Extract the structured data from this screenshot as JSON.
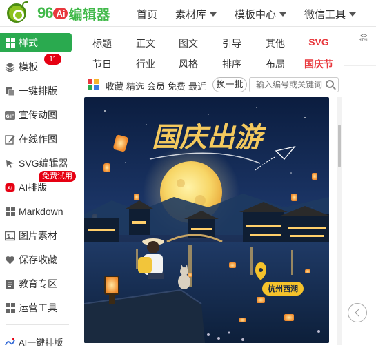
{
  "logo": {
    "num": "96",
    "ai": "Ai",
    "text": "编辑器"
  },
  "nav": {
    "items": [
      {
        "label": "首页",
        "dropdown": false
      },
      {
        "label": "素材库",
        "dropdown": true
      },
      {
        "label": "模板中心",
        "dropdown": true
      },
      {
        "label": "微信工具",
        "dropdown": true
      }
    ]
  },
  "sidebar": {
    "items": [
      {
        "label": "样式",
        "icon": "grid-icon",
        "active": true
      },
      {
        "label": "模板",
        "icon": "layers-icon",
        "badge": "11"
      },
      {
        "label": "一键排版",
        "icon": "copy-icon"
      },
      {
        "label": "宣传动图",
        "icon": "gif-icon"
      },
      {
        "label": "在线作图",
        "icon": "edit-icon"
      },
      {
        "label": "SVG编辑器",
        "icon": "cursor-icon"
      },
      {
        "label": "AI排版",
        "icon": "ai-icon",
        "badge": "免费试用"
      },
      {
        "label": "Markdown",
        "icon": "grid-icon"
      },
      {
        "label": "图片素材",
        "icon": "image-icon"
      },
      {
        "label": "保存收藏",
        "icon": "heart-icon"
      },
      {
        "label": "教育专区",
        "icon": "book-icon"
      },
      {
        "label": "运营工具",
        "icon": "grid-icon"
      },
      {
        "label": "AI一键排版",
        "icon": "ai-wand-icon"
      }
    ]
  },
  "categories": {
    "row1": [
      "标题",
      "正文",
      "图文",
      "引导",
      "其他",
      "SVG"
    ],
    "row2": [
      "节日",
      "行业",
      "风格",
      "排序",
      "布局",
      "国庆节"
    ]
  },
  "filters": {
    "links": [
      "收藏",
      "精选",
      "会员",
      "免费",
      "最近"
    ],
    "swap_label": "换一批",
    "search_placeholder": "输入编号或关键词"
  },
  "poster": {
    "title": "国庆出游",
    "location": "杭州西湖"
  },
  "right_panel": {
    "html_label": "HTML"
  },
  "colors": {
    "brand_green": "#2aaa4f",
    "accent_red": "#e8383d",
    "badge_red": "#e60012"
  }
}
